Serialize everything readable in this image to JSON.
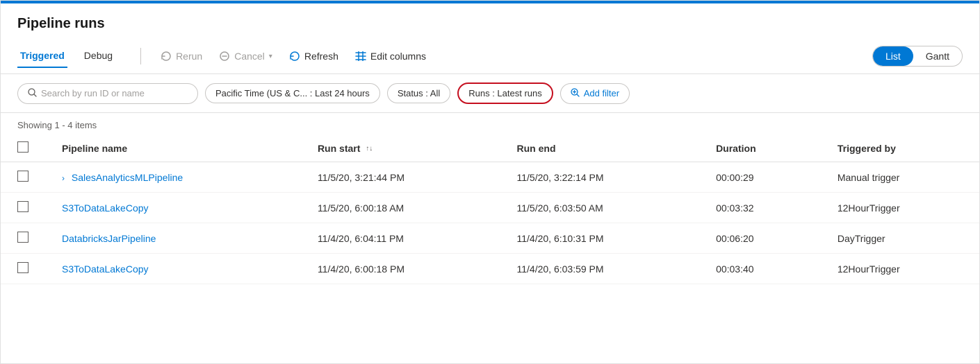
{
  "page": {
    "title": "Pipeline runs",
    "topBarColor": "#0078d4"
  },
  "toolbar": {
    "tabs": [
      {
        "id": "triggered",
        "label": "Triggered",
        "active": true
      },
      {
        "id": "debug",
        "label": "Debug",
        "active": false
      }
    ],
    "actions": [
      {
        "id": "rerun",
        "label": "Rerun",
        "icon": "↺",
        "disabled": true
      },
      {
        "id": "cancel",
        "label": "Cancel",
        "icon": "⊘",
        "disabled": true,
        "hasDropdown": true
      },
      {
        "id": "refresh",
        "label": "Refresh",
        "icon": "↻",
        "disabled": false
      },
      {
        "id": "edit-columns",
        "label": "Edit columns",
        "icon": "≡≡",
        "disabled": false
      }
    ],
    "toggle": {
      "options": [
        {
          "id": "list",
          "label": "List",
          "active": true
        },
        {
          "id": "gantt",
          "label": "Gantt",
          "active": false
        }
      ]
    }
  },
  "filters": {
    "search_placeholder": "Search by run ID or name",
    "time_filter": "Pacific Time (US & C... : Last 24 hours",
    "status_filter": "Status : All",
    "runs_filter": "Runs : Latest runs",
    "add_filter_label": "Add filter"
  },
  "table": {
    "showing_text": "Showing 1 - 4 items",
    "columns": [
      {
        "id": "checkbox",
        "label": ""
      },
      {
        "id": "pipeline-name",
        "label": "Pipeline name"
      },
      {
        "id": "run-start",
        "label": "Run start",
        "sortable": true
      },
      {
        "id": "run-end",
        "label": "Run end"
      },
      {
        "id": "duration",
        "label": "Duration"
      },
      {
        "id": "triggered-by",
        "label": "Triggered by"
      }
    ],
    "rows": [
      {
        "id": "row-1",
        "pipeline_name": "SalesAnalyticsMLPipeline",
        "has_expander": true,
        "run_start": "11/5/20, 3:21:44 PM",
        "run_end": "11/5/20, 3:22:14 PM",
        "duration": "00:00:29",
        "triggered_by": "Manual trigger"
      },
      {
        "id": "row-2",
        "pipeline_name": "S3ToDataLakeCopy",
        "has_expander": false,
        "run_start": "11/5/20, 6:00:18 AM",
        "run_end": "11/5/20, 6:03:50 AM",
        "duration": "00:03:32",
        "triggered_by": "12HourTrigger"
      },
      {
        "id": "row-3",
        "pipeline_name": "DatabricksJarPipeline",
        "has_expander": false,
        "run_start": "11/4/20, 6:04:11 PM",
        "run_end": "11/4/20, 6:10:31 PM",
        "duration": "00:06:20",
        "triggered_by": "DayTrigger"
      },
      {
        "id": "row-4",
        "pipeline_name": "S3ToDataLakeCopy",
        "has_expander": false,
        "run_start": "11/4/20, 6:00:18 PM",
        "run_end": "11/4/20, 6:03:59 PM",
        "duration": "00:03:40",
        "triggered_by": "12HourTrigger"
      }
    ]
  }
}
